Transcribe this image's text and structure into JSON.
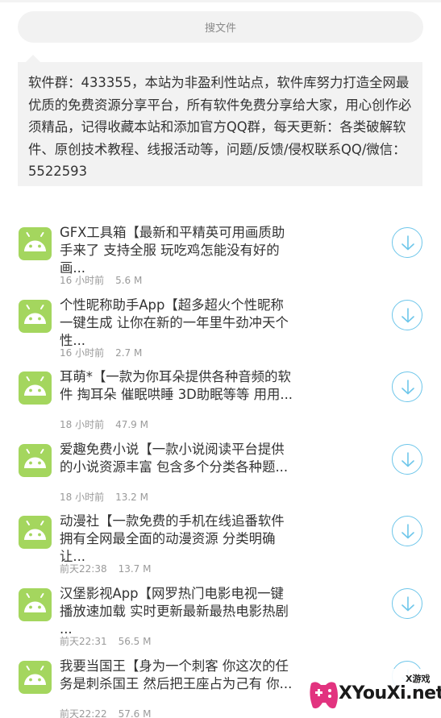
{
  "search": {
    "placeholder": "搜文件"
  },
  "notice": {
    "text": "软件群：433355，本站为非盈利性站点，软件库努力打造全网最优质的免费资源分享平台，所有软件免费分享给大家，用心创作必须精品，记得收藏本站和添加官方QQ群，每天更新：各类破解软件、原创技术教程、线报活动等，问题/反馈/侵权联系QQ/微信：5522593"
  },
  "files": [
    {
      "title": "GFX工具箱【最新和平精英可用画质助手来了 支持全服 玩吃鸡怎能没有好的画...",
      "time": "16 小时前",
      "size": "5.6 M"
    },
    {
      "title": "个性昵称助手App【超多超火个性昵称一键生成 让你在新的一年里牛劲冲天个性...",
      "time": "16 小时前",
      "size": "2.7 M"
    },
    {
      "title": "耳萌*【一款为你耳朵提供各种音频的软件 掏耳朵 催眠哄睡 3D助眠等等 用用...",
      "time": "18 小时前",
      "size": "47.9 M"
    },
    {
      "title": "爱趣免费小说【一款小说阅读平台提供的小说资源丰富 包含多个分类各种题...",
      "time": "18 小时前",
      "size": "13.2 M"
    },
    {
      "title": "动漫社【一款免费的手机在线追番软件 拥有全网最全面的动漫资源 分类明确让...",
      "time": "前天22:38",
      "size": "13.7 M"
    },
    {
      "title": "汉堡影视App【网罗热门电影电视一键播放速加载 实时更新最新最热电影热剧 ...",
      "time": "前天22:31",
      "size": "56.5 M"
    },
    {
      "title": "我要当国王【身为一个刺客 你这次的任务是刺杀国王 然后把王座占为己有 你...",
      "time": "前天22:22",
      "size": "57.6 M"
    }
  ],
  "watermark": {
    "small": "X游戏",
    "big": "XYouXi.net"
  },
  "colors": {
    "icon_bg": "#a4d65e",
    "download_blue": "#6ec6ea",
    "panel_bg": "#f2f2f2"
  },
  "icons": {
    "app": "android-icon",
    "download": "download-circle-icon"
  }
}
